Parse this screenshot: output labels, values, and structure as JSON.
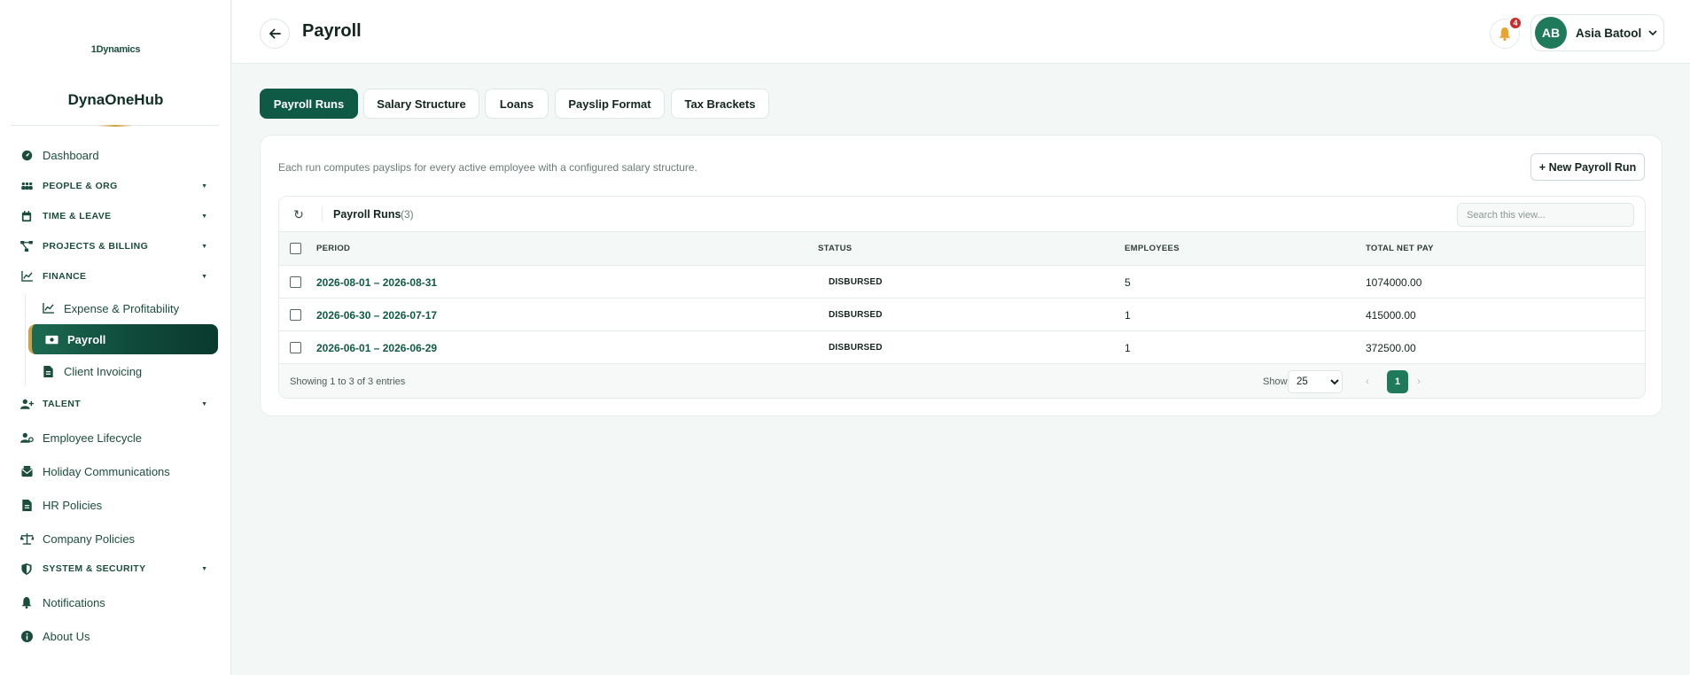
{
  "sidebar": {
    "logo_text": "1Dynamics",
    "brand": "DynaOneHub",
    "items": {
      "dashboard": "Dashboard",
      "people_org": "PEOPLE & ORG",
      "time_leave": "TIME & LEAVE",
      "projects_billing": "PROJECTS & BILLING",
      "finance": "FINANCE",
      "expense": "Expense & Profitability",
      "payroll": "Payroll",
      "client_invoicing": "Client Invoicing",
      "talent": "TALENT",
      "employee_lifecycle": "Employee Lifecycle",
      "holiday_communications": "Holiday Communications",
      "hr_policies": "HR Policies",
      "company_policies": "Company Policies",
      "system_security": "SYSTEM & SECURITY",
      "notifications": "Notifications",
      "about_us": "About Us"
    }
  },
  "header": {
    "title": "Payroll",
    "notification_count": "4",
    "user_initials": "AB",
    "user_name": "Asia Batool"
  },
  "tabs": {
    "payroll_runs": "Payroll Runs",
    "salary_structure": "Salary Structure",
    "loans": "Loans",
    "payslip_format": "Payslip Format",
    "tax_brackets": "Tax Brackets"
  },
  "card": {
    "description": "Each run computes payslips for every active employee with a configured salary structure.",
    "new_button": "+ New Payroll Run"
  },
  "table": {
    "title": "Payroll Runs",
    "count": "(3)",
    "search_placeholder": "Search this view...",
    "columns": {
      "period": "PERIOD",
      "status": "STATUS",
      "employees": "EMPLOYEES",
      "total_net_pay": "TOTAL NET PAY"
    },
    "rows": [
      {
        "period": "2026-08-01 – 2026-08-31",
        "status": "DISBURSED",
        "employees": "5",
        "total_net_pay": "1074000.00"
      },
      {
        "period": "2026-06-30 – 2026-07-17",
        "status": "DISBURSED",
        "employees": "1",
        "total_net_pay": "415000.00"
      },
      {
        "period": "2026-06-01 – 2026-06-29",
        "status": "DISBURSED",
        "employees": "1",
        "total_net_pay": "372500.00"
      }
    ],
    "footer": {
      "showing": "Showing 1 to 3 of 3 entries",
      "show_label": "Show",
      "page_size": "25",
      "current_page": "1"
    }
  },
  "colors": {
    "primary": "#0f5a45",
    "accent_gold": "#c9a24a",
    "badge_red": "#c62e2e"
  }
}
